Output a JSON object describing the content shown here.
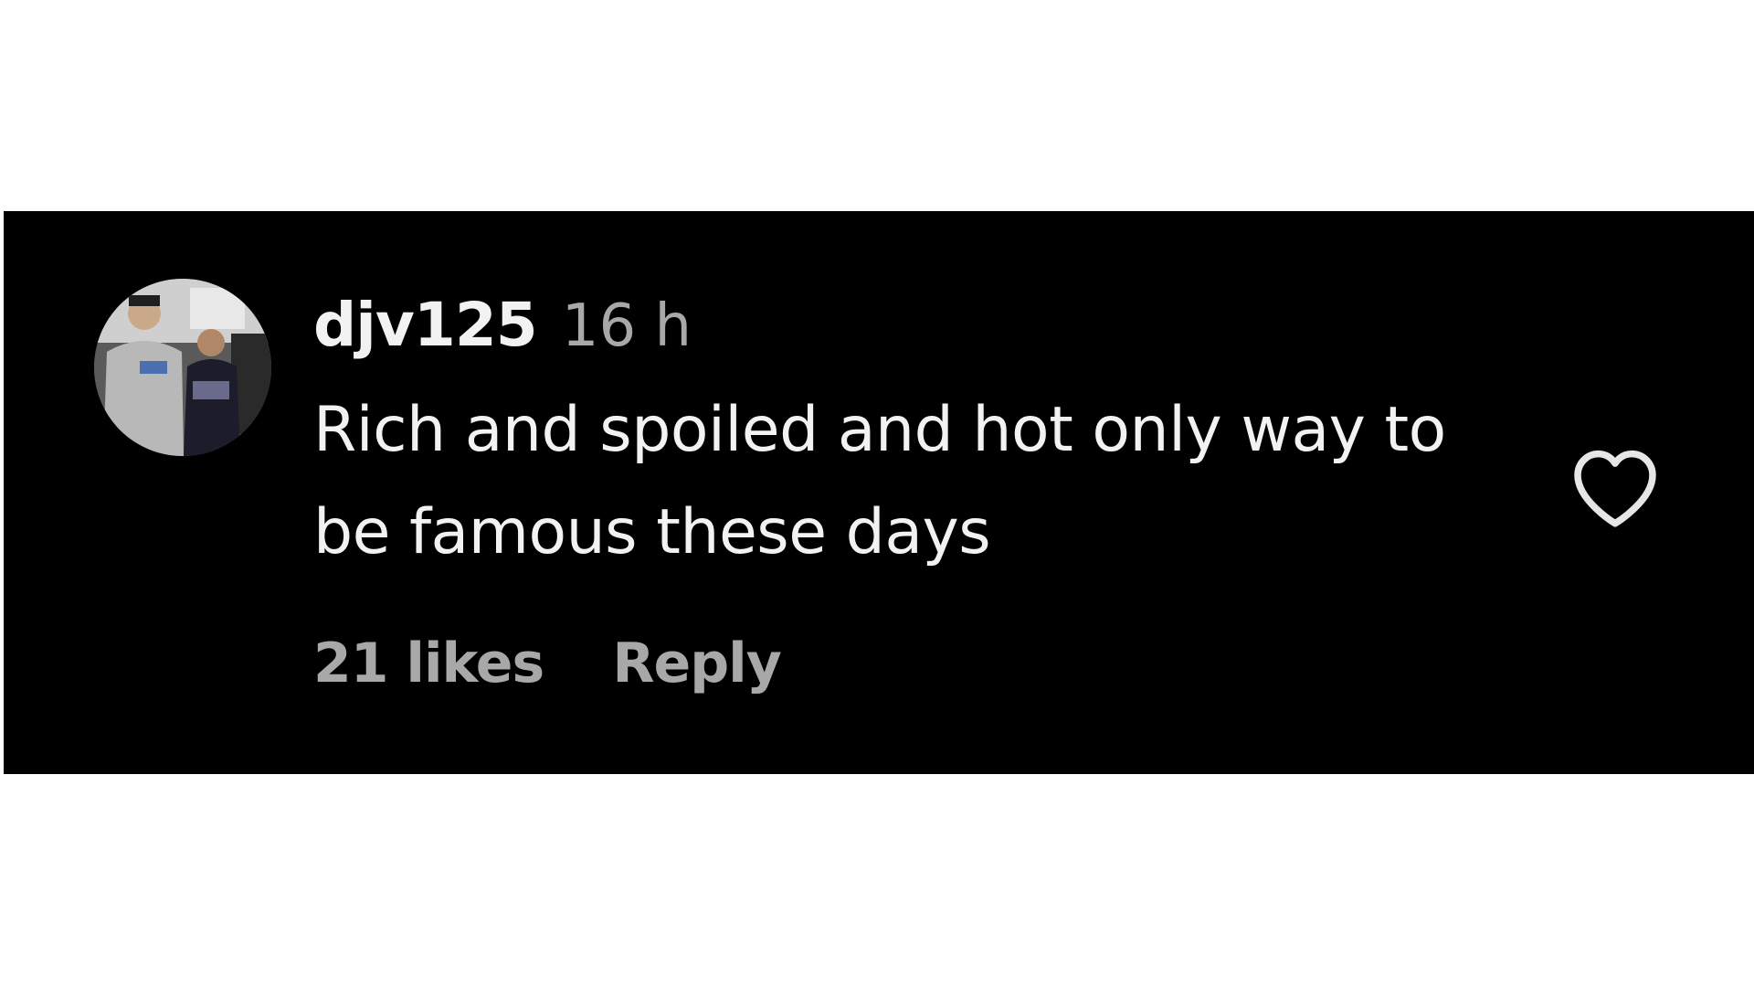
{
  "comment": {
    "username": "djv125",
    "timestamp": "16 h",
    "text": "Rich and spoiled and hot only way to be famous these days",
    "likes_label": "21 likes",
    "reply_label": "Reply",
    "avatar_icon": "profile-photo-avatar",
    "like_icon": "heart-outline-icon"
  },
  "colors": {
    "panel_background": "#000000",
    "primary_text": "#f2f2f2",
    "secondary_text": "#a8a8a8",
    "page_background": "#ffffff"
  }
}
